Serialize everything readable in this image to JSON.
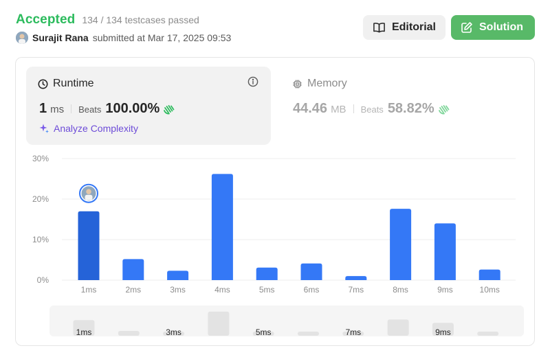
{
  "header": {
    "status": "Accepted",
    "testcases": "134 / 134 testcases passed",
    "username": "Surajit Rana",
    "submitted_text": "submitted at Mar 17, 2025 09:53",
    "editorial_label": "Editorial",
    "solution_label": "Solution"
  },
  "runtime": {
    "title": "Runtime",
    "value": "1",
    "unit": "ms",
    "beats_label": "Beats",
    "beats_value": "100.00%",
    "analyze_label": "Analyze Complexity"
  },
  "memory": {
    "title": "Memory",
    "value": "44.46",
    "unit": "MB",
    "beats_label": "Beats",
    "beats_value": "58.82%"
  },
  "colors": {
    "accepted": "#2cbb5d",
    "solution_button": "#58b968",
    "bar": "#3478f6",
    "bar_selected": "#2563d8",
    "analyze": "#6d4cd8"
  },
  "icons": [
    "clock-icon",
    "info-icon",
    "chip-icon",
    "clap-icon",
    "sparkle-icon",
    "book-icon",
    "edit-icon"
  ],
  "chart_data": {
    "type": "bar",
    "categories": [
      "1ms",
      "2ms",
      "3ms",
      "4ms",
      "5ms",
      "6ms",
      "7ms",
      "8ms",
      "9ms",
      "10ms"
    ],
    "values": [
      17.0,
      5.2,
      2.3,
      26.2,
      3.1,
      4.1,
      1.0,
      17.6,
      14.0,
      2.6
    ],
    "y_ticks": [
      "30%",
      "20%",
      "10%",
      "0%"
    ],
    "ylim": [
      0,
      30
    ],
    "grid": true,
    "highlighted_category": "1ms",
    "navigator_labels": [
      "1ms",
      "3ms",
      "5ms",
      "7ms",
      "9ms"
    ]
  }
}
